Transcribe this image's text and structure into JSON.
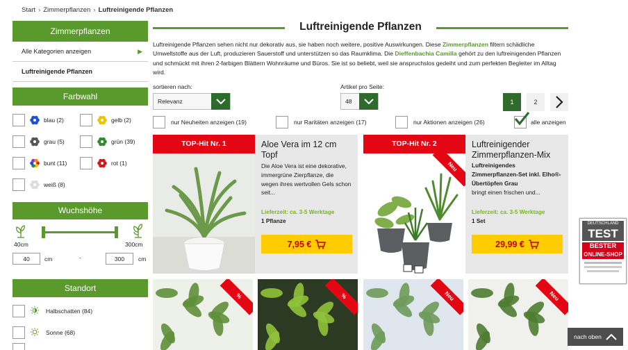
{
  "breadcrumb": {
    "items": [
      "Start",
      "Zimmerpflanzen"
    ],
    "current": "Luftreinigende Pflanzen"
  },
  "sidebar": {
    "category_head": "Zimmerpflanzen",
    "all_categories": "Alle Kategorien anzeigen",
    "active_category": "Luftreinigende Pflanzen",
    "color_head": "Farbwahl",
    "colors": [
      {
        "label": "blau (2)",
        "color": "#1d4fd8"
      },
      {
        "label": "gelb (2)",
        "color": "#f2c200"
      },
      {
        "label": "grau (5)",
        "color": "#555555"
      },
      {
        "label": "grün (39)",
        "color": "#2e8b2e"
      },
      {
        "label": "bunt (11)",
        "color": "multi"
      },
      {
        "label": "rot (1)",
        "color": "#d01818"
      },
      {
        "label": "weiß (8)",
        "color": "#dddddd"
      }
    ],
    "height_head": "Wuchshöhe",
    "height_min_label": "40cm",
    "height_max_label": "300cm",
    "height_min_value": "40",
    "height_max_value": "300",
    "unit": "cm",
    "dash": "-",
    "location_head": "Standort",
    "locations": [
      "Halbschatten (84)",
      "Sonne (68)"
    ]
  },
  "main": {
    "title": "Luftreinigende Pflanzen",
    "intro_1": "Luftreinigende Pflanzen sehen nicht nur dekorativ aus, sie haben noch weitere, positive Auswirkungen. Diese ",
    "intro_link_1": "Zimmerpflanzen",
    "intro_2": " filtern schädliche Umweltstoffe aus der Luft, produzieren Sauerstoff und unterstützen so das Raumklima. Die ",
    "intro_link_2": "Dieffenbachia Camilla",
    "intro_3": " gehört zu den luftreinigenden Pflanzen und schmückt mit ihren 2-farbigen Blättern Wohnräume und Büros. Sie ist so beliebt, weil sie anspruchslos gedeiht und zum perfekten Begleiter im Alltag wird."
  },
  "controls": {
    "sort_label": "sortieren nach:",
    "sort_value": "Relevanz",
    "per_page_label": "Artikel pro Seite:",
    "per_page_value": "48",
    "pages": [
      "1",
      "2"
    ],
    "current_page": "1"
  },
  "filters": [
    "nur Neuheiten anzeigen (19)",
    "nur Raritäten anzeigen (17)",
    "nur Aktionen anzeigen (26)",
    "alle anzeigen"
  ],
  "products": [
    {
      "badge": "TOP-Hit Nr. 1",
      "name": "Aloe Vera im 12 cm Topf",
      "desc": "Die Aloe Vera ist eine dekorative, immergrüne Zierpflanze, die wegen ihres wertvollen Gels schon seit...",
      "delivery": "Lieferzeit: ca. 3-5 Werktage",
      "unit": "1 Pflanze",
      "price": "7,95 €"
    },
    {
      "badge": "TOP-Hit Nr. 2",
      "corner": "Neu",
      "name": "Luftreinigender Zimmerpflanzen-Mix",
      "desc": "Luftreinigendes Zimmerpflanzen-Set inkl. Elho®-Übertöpfen Grau",
      "desc2": "bringt einen frischen und...",
      "delivery": "Lieferzeit: ca. 3-5 Werktage",
      "unit": "1 Set",
      "price": "29,99 €"
    }
  ],
  "tiles": [
    "%",
    "%",
    "Neu",
    "Neu"
  ],
  "seal": {
    "l1": "DEUTSCHLAND",
    "l2": "TEST",
    "l3": "BESTER",
    "l4": "ONLINE-SHOP"
  },
  "back_to_top": "nach oben"
}
